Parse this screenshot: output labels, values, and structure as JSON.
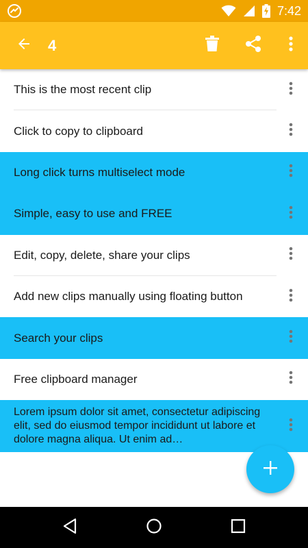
{
  "status_bar": {
    "time": "7:42",
    "icons": [
      "app-notification-icon",
      "wifi-icon",
      "cellular-icon",
      "battery-charging-icon"
    ]
  },
  "app_bar": {
    "selected_count": "4",
    "icons": [
      "arrow-back-icon",
      "trash-icon",
      "share-icon",
      "more-vert-icon"
    ]
  },
  "colors": {
    "status_bar": "#f0a500",
    "app_bar": "#ffc11e",
    "selected_row": "#19bff7",
    "fab": "#19bff7",
    "nav_bar": "#000000"
  },
  "clips": [
    {
      "text": "This is the most recent clip",
      "selected": false
    },
    {
      "text": "Click to copy to clipboard",
      "selected": false
    },
    {
      "text": "Long click turns multiselect mode",
      "selected": true
    },
    {
      "text": "Simple, easy to use and FREE",
      "selected": true
    },
    {
      "text": "Edit, copy, delete, share your clips",
      "selected": false
    },
    {
      "text": "Add new clips manually using floating button",
      "selected": false
    },
    {
      "text": "Search your clips",
      "selected": true
    },
    {
      "text": "Free clipboard manager",
      "selected": false
    },
    {
      "text": "Lorem ipsum dolor sit amet, consectetur adipiscing elit, sed do eiusmod tempor incididunt ut labore et dolore magna aliqua. Ut enim ad…",
      "selected": true
    }
  ],
  "fab": {
    "icon": "plus-icon"
  },
  "nav_bar": {
    "icons": [
      "back-triangle-icon",
      "home-circle-icon",
      "recents-square-icon"
    ]
  }
}
